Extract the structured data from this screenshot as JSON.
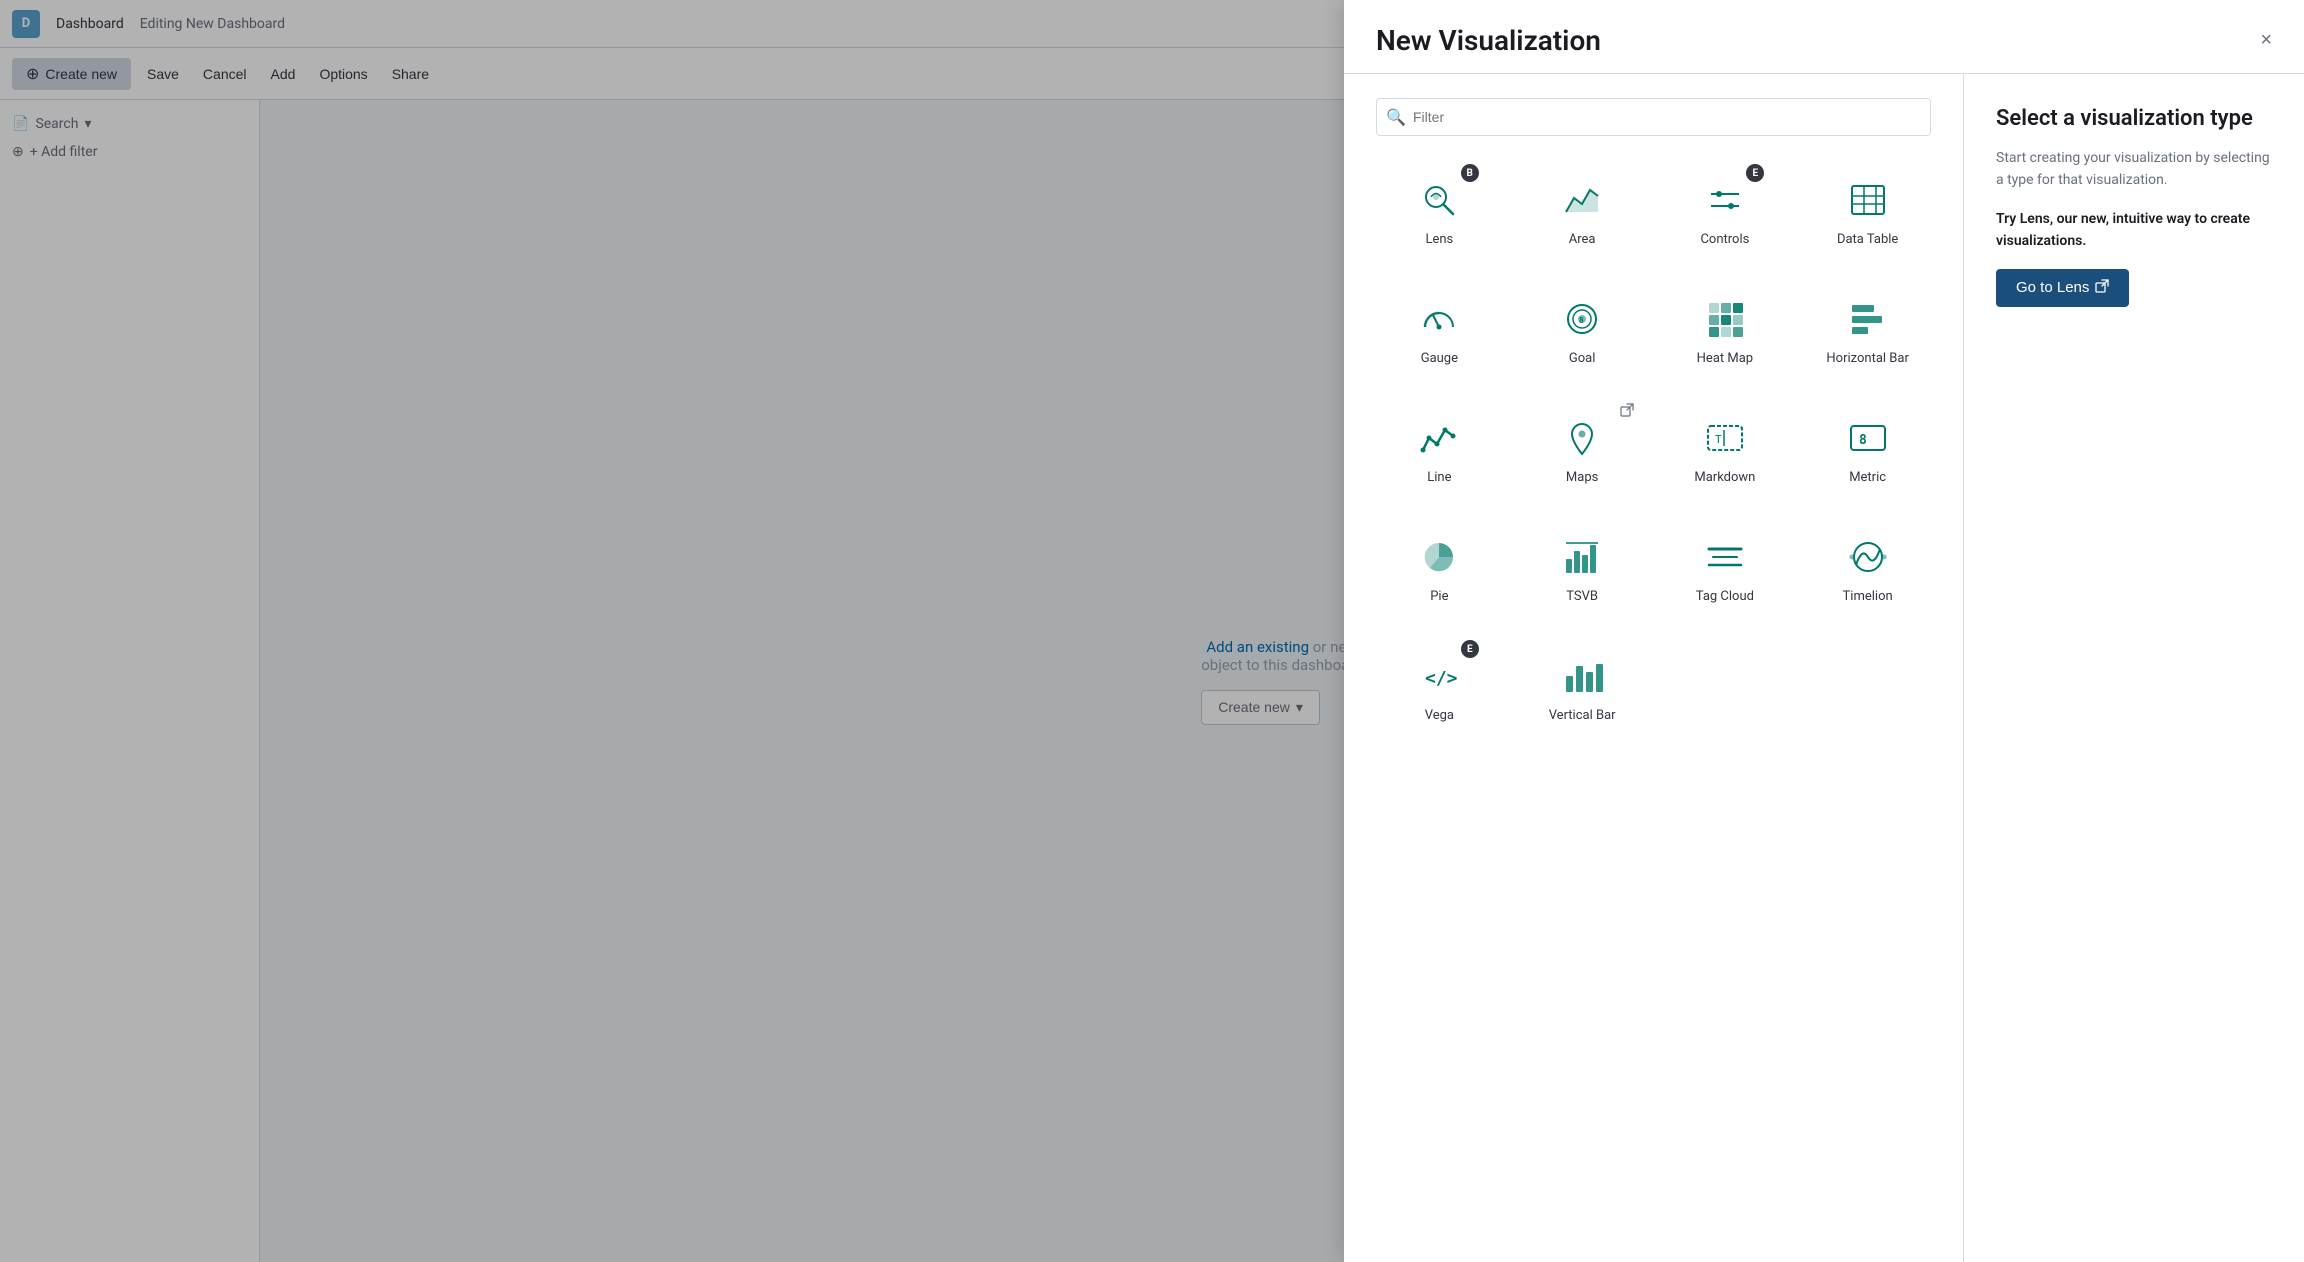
{
  "topNav": {
    "avatarLabel": "D",
    "dashboardLabel": "Dashboard",
    "editingLabel": "Editing New Dashboard"
  },
  "toolbar": {
    "createNewLabel": "Create new",
    "saveLabel": "Save",
    "cancelLabel": "Cancel",
    "addLabel": "Add",
    "optionsLabel": "Options",
    "shareLabel": "Share"
  },
  "sidebar": {
    "searchLabel": "Search",
    "addFilterLabel": "+ Add filter"
  },
  "mainArea": {
    "emptyText1": "Add an existing",
    "emptyText2": "or new",
    "emptyText3": "object to this dashboard",
    "createNewLabel": "Create new"
  },
  "modal": {
    "title": "New Visualization",
    "closeLabel": "×",
    "filter": {
      "placeholder": "Filter"
    },
    "vizItems": [
      {
        "id": "lens",
        "label": "Lens",
        "badge": "B",
        "badgeType": "beta"
      },
      {
        "id": "area",
        "label": "Area",
        "badge": null
      },
      {
        "id": "controls",
        "label": "Controls",
        "badge": "E",
        "badgeType": "exp"
      },
      {
        "id": "data-table",
        "label": "Data Table",
        "badge": null
      },
      {
        "id": "gauge",
        "label": "Gauge",
        "badge": null
      },
      {
        "id": "goal",
        "label": "Goal",
        "badge": null
      },
      {
        "id": "heat-map",
        "label": "Heat Map",
        "badge": null
      },
      {
        "id": "horizontal-bar",
        "label": "Horizontal Bar",
        "badge": null
      },
      {
        "id": "line",
        "label": "Line",
        "badge": null
      },
      {
        "id": "maps",
        "label": "Maps",
        "badge": null,
        "extLink": true
      },
      {
        "id": "markdown",
        "label": "Markdown",
        "badge": null
      },
      {
        "id": "metric",
        "label": "Metric",
        "badge": null
      },
      {
        "id": "pie",
        "label": "Pie",
        "badge": null
      },
      {
        "id": "tsvb",
        "label": "TSVB",
        "badge": null
      },
      {
        "id": "tag-cloud",
        "label": "Tag Cloud",
        "badge": null
      },
      {
        "id": "timelion",
        "label": "Timelion",
        "badge": null
      },
      {
        "id": "vega",
        "label": "Vega",
        "badge": "E",
        "badgeType": "exp"
      },
      {
        "id": "vertical-bar",
        "label": "Vertical Bar",
        "badge": null
      }
    ],
    "infoPanel": {
      "title": "Select a visualization type",
      "description": "Start creating your visualization by selecting a type for that visualization.",
      "cta": "Try Lens, our new, intuitive way to create visualizations.",
      "goToLensLabel": "Go to Lens"
    }
  }
}
